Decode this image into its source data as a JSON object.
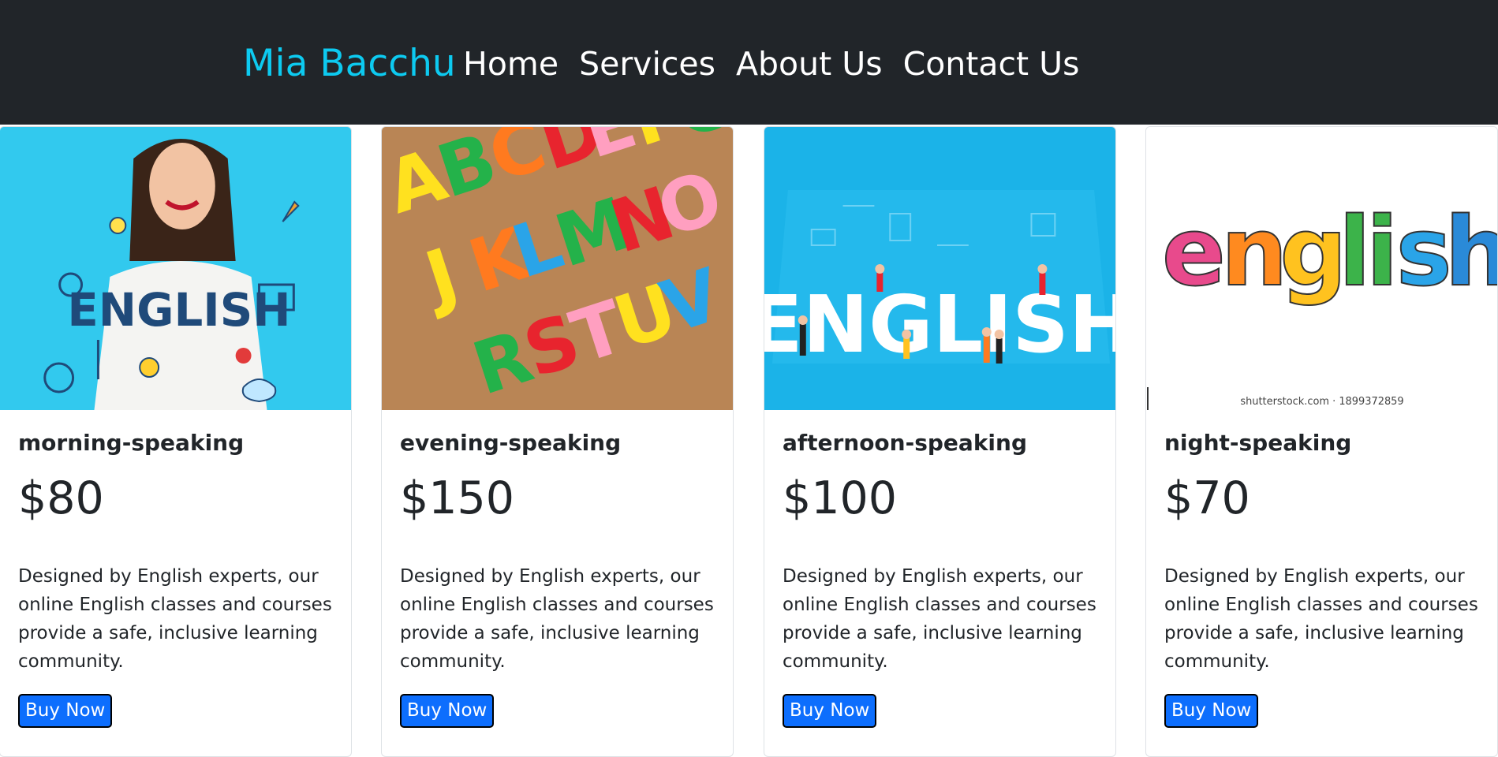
{
  "navbar": {
    "brand": "Mia Bacchu",
    "links": [
      "Home",
      "Services",
      "About Us",
      "Contact Us"
    ]
  },
  "cards": [
    {
      "title": "morning-speaking",
      "price": "$80",
      "description": "Designed by English experts, our online English classes and courses provide a safe, inclusive learning community.",
      "button": "Buy Now",
      "image_text": "ENGLISH"
    },
    {
      "title": "evening-speaking",
      "price": "$150",
      "description": "Designed by English experts, our online English classes and courses provide a safe, inclusive learning community.",
      "button": "Buy Now",
      "image_text": "ABCDEFGHI JKLMNOPQ RSTUVW"
    },
    {
      "title": "afternoon-speaking",
      "price": "$100",
      "description": "Designed by English experts, our online English classes and courses provide a safe, inclusive learning community.",
      "button": "Buy Now",
      "image_text": "ENGLISH"
    },
    {
      "title": "night-speaking",
      "price": "$70",
      "description": "Designed by English experts, our online English classes and courses provide a safe, inclusive learning community.",
      "button": "Buy Now",
      "image_text": "english",
      "image_caption": "shutterstock.com · 1899372859"
    }
  ],
  "colors": {
    "navbar_bg": "#212529",
    "brand": "#0dcaf0",
    "button_bg": "#0d6efd",
    "text": "#212529"
  }
}
